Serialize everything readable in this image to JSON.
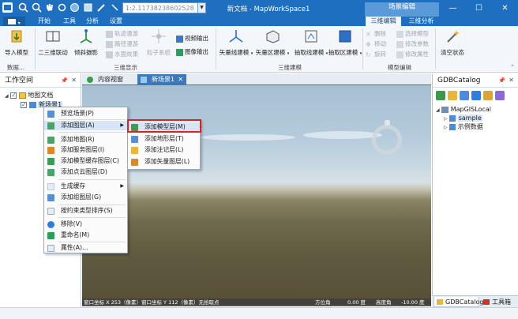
{
  "app": {
    "title": "新文档 - MapWorkSpace1"
  },
  "titlebar": {
    "scale_value": "1:2.11738238602528"
  },
  "ribbon_tabs": {
    "file": "",
    "items": [
      "开始",
      "工具",
      "分析",
      "设置"
    ],
    "context_group": "场景编辑",
    "context_tabs": [
      "三维编辑",
      "三维分析"
    ]
  },
  "ribbon": {
    "import_model": "导入模型",
    "group_data": "数据...",
    "btn_23d": "二三维联动",
    "btn_tilt": "倾斜摄影",
    "dis_track": "轨迹漫游",
    "dis_path": "路径漫游",
    "dis_water": "水面效果",
    "particle": "粒子系统",
    "video_out": "视频输出",
    "image_out": "图像输出",
    "group_display": "三维显示",
    "vec_line": "矢量线建模",
    "vec_area": "矢量区建模",
    "ext_line": "抽取线建模",
    "ext_area": "抽取区建模",
    "group_model3d": "三维建模",
    "del": "删除",
    "move": "移动",
    "rotate": "旋转",
    "sel_model": "选择模型",
    "edit_param": "修改参数",
    "edit_attr": "修改属性",
    "group_model_edit": "模型编辑",
    "clear_state": "清空状态"
  },
  "workspace": {
    "title": "工作空间",
    "tree": {
      "root": "地图文档",
      "child": "新场景1"
    }
  },
  "doc_tabs": [
    "内容视窗",
    "新场景1"
  ],
  "context_menu": {
    "items": [
      "预览场景(P)",
      "添加图层(A)",
      "添加地图(R)",
      "添加服务图层(I)",
      "添加模型缓存图层(C)",
      "添加点云图层(D)",
      "生成缓存",
      "添加组图层(G)",
      "按约束类型排序(S)",
      "移除(V)",
      "重命名(M)",
      "属性(A)..."
    ]
  },
  "submenu": {
    "items": [
      "添加模型层(M)",
      "添加地形层(T)",
      "添加注记层(L)",
      "添加矢量图层(L)"
    ]
  },
  "status": {
    "left": "窗口坐标 X 253（像素）窗口坐标 Y 112（像素）无拾取点",
    "azimuth_label": "方位角",
    "azimuth": "0.00 度",
    "elevation_label": "高度角",
    "elevation": "-10.00 度"
  },
  "gdb": {
    "title": "GDBCatalog",
    "root": "MapGISLocal",
    "items": [
      "sample",
      "示例数据"
    ]
  },
  "bottom_tabs": [
    "GDBCatalog",
    "工具箱"
  ]
}
